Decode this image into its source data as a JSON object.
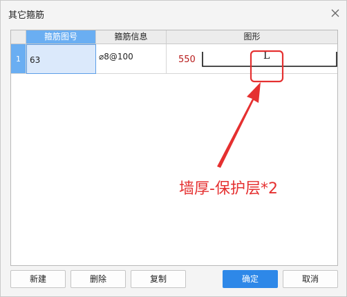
{
  "dialog": {
    "title": "其它箍筋"
  },
  "table": {
    "columns": [
      "箍筋图号",
      "箍筋信息",
      "图形"
    ],
    "rows": [
      {
        "row_number": "1",
        "code": "63",
        "info": "⌀8@100",
        "shape_value": "550",
        "shape_label": "L"
      }
    ]
  },
  "annotation": {
    "text": "墙厚-保护层*2",
    "color": "#e53030"
  },
  "buttons": {
    "new": "新建",
    "delete": "删除",
    "copy": "复制",
    "ok": "确定",
    "cancel": "取消"
  },
  "colors": {
    "accent": "#2e88e8",
    "header_selected": "#6aaef2",
    "shape_value": "#b81c1c"
  }
}
